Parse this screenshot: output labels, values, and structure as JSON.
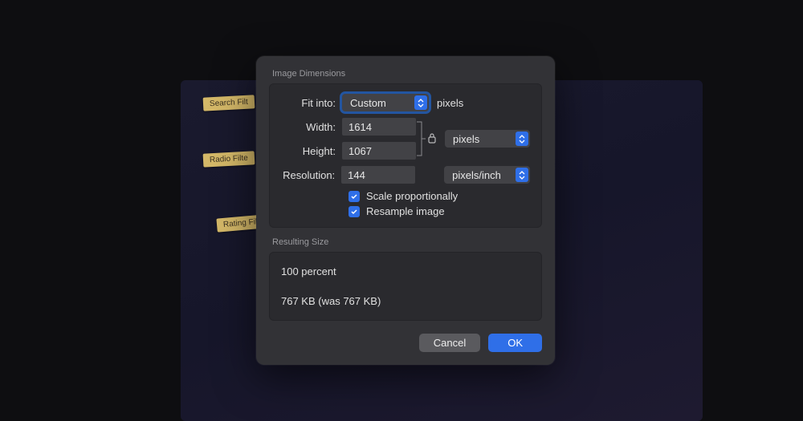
{
  "background": {
    "tags": [
      "Search Filt",
      "Radio Filte",
      "Rating Filt"
    ]
  },
  "dialog": {
    "dimensions": {
      "title": "Image Dimensions",
      "fit_into_label": "Fit into:",
      "fit_into_value": "Custom",
      "fit_into_unit": "pixels",
      "width_label": "Width:",
      "width_value": "1614",
      "height_label": "Height:",
      "height_value": "1067",
      "wh_unit": "pixels",
      "resolution_label": "Resolution:",
      "resolution_value": "144",
      "resolution_unit": "pixels/inch",
      "scale_label": "Scale proportionally",
      "resample_label": "Resample image"
    },
    "result": {
      "title": "Resulting Size",
      "percent": "100 percent",
      "size": "767 KB (was 767 KB)"
    },
    "buttons": {
      "cancel": "Cancel",
      "ok": "OK"
    }
  }
}
